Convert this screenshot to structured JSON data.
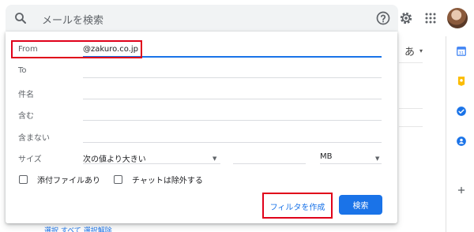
{
  "search": {
    "placeholder": "メールを検索"
  },
  "toolbar": {
    "help_icon": "help-circle-icon",
    "settings_icon": "gear-icon",
    "apps_icon": "apps-grid-icon"
  },
  "background": {
    "lang_label": "あ",
    "link_fragment": "選択 すべて 選択解除"
  },
  "filter_panel": {
    "from_label": "From",
    "from_value": "@zakuro.co.jp",
    "to_label": "To",
    "subject_label": "件名",
    "has_words_label": "含む",
    "doesnt_have_label": "含まない",
    "size_label": "サイズ",
    "size_comparator": "次の値より大きい",
    "size_value": "",
    "size_unit": "MB",
    "has_attachment_label": "添付ファイルあり",
    "exclude_chats_label": "チャットは除外する",
    "create_filter_button": "フィルタを作成",
    "search_button": "検索"
  },
  "colors": {
    "primary": "#1a73e8",
    "highlight": "#e0001a"
  }
}
